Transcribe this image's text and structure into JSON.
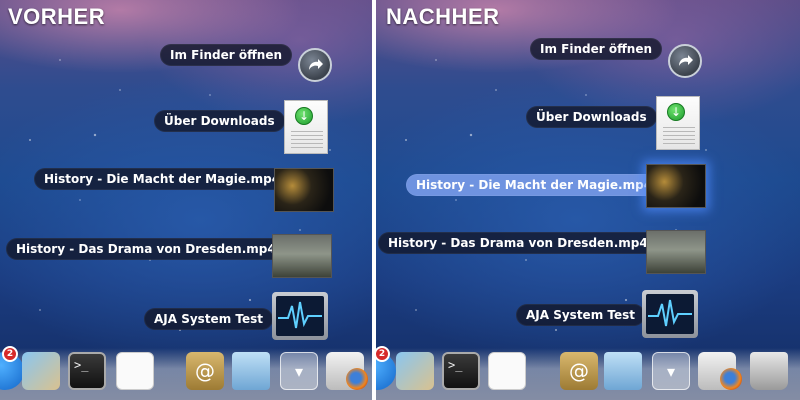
{
  "before": {
    "heading": "VORHER",
    "items": [
      {
        "label": "Im Finder öffnen",
        "icon": "arrow-circle-icon"
      },
      {
        "label": "Über Downloads",
        "icon": "document-icon"
      },
      {
        "label": "History - Die Macht der Magie.mp4",
        "icon": "video-thumbnail-icon"
      },
      {
        "label": "History - Das Drama von Dresden.mp4",
        "icon": "video-thumbnail-icon"
      },
      {
        "label": "AJA System Test",
        "icon": "aja-app-icon"
      }
    ],
    "dock_badge": "2"
  },
  "after": {
    "heading": "NACHHER",
    "items": [
      {
        "label": "Im Finder öffnen",
        "icon": "arrow-circle-icon"
      },
      {
        "label": "Über Downloads",
        "icon": "document-icon"
      },
      {
        "label": "History - Die Macht der Magie.mp4",
        "icon": "video-thumbnail-icon",
        "selected": true
      },
      {
        "label": "History - Das Drama von Dresden.mp4",
        "icon": "video-thumbnail-icon"
      },
      {
        "label": "AJA System Test",
        "icon": "aja-app-icon"
      }
    ],
    "dock_badge": "2"
  },
  "colors": {
    "highlight": "#6f93e0",
    "label_bg": "#12162a"
  }
}
